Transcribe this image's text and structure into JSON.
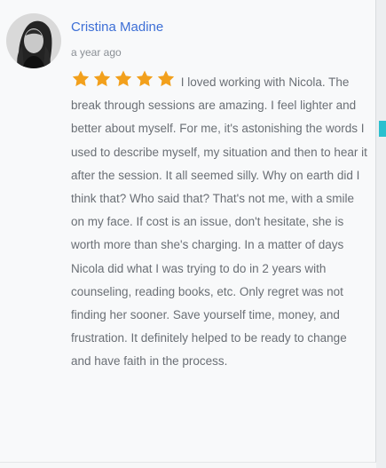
{
  "author": {
    "name": "Cristina Madine",
    "time": "a year ago"
  },
  "rating": {
    "value": 5,
    "max": 5,
    "icon": "star-icon",
    "color": "#f2a01c"
  },
  "review": {
    "text": "I loved working with Nicola. The break through sessions are amazing. I feel lighter and better about myself. For me, it's astonishing the words I used to describe myself, my situation and then to hear it after the session. It all seemed silly. Why on earth did I think that? Who said that? That's not me, with a smile on my face. If cost is an issue, don't hesitate, she is worth more than she's charging. In a matter of days Nicola did what I was trying to do in 2 years with counseling, reading books, etc. Only regret was not finding her sooner. Save yourself time, money, and frustration. It definitely helped to be ready to change and have faith in the process."
  },
  "colors": {
    "author": "#3d6fd6",
    "body_text": "#6a6f75",
    "accent": "#2ac0cf"
  }
}
